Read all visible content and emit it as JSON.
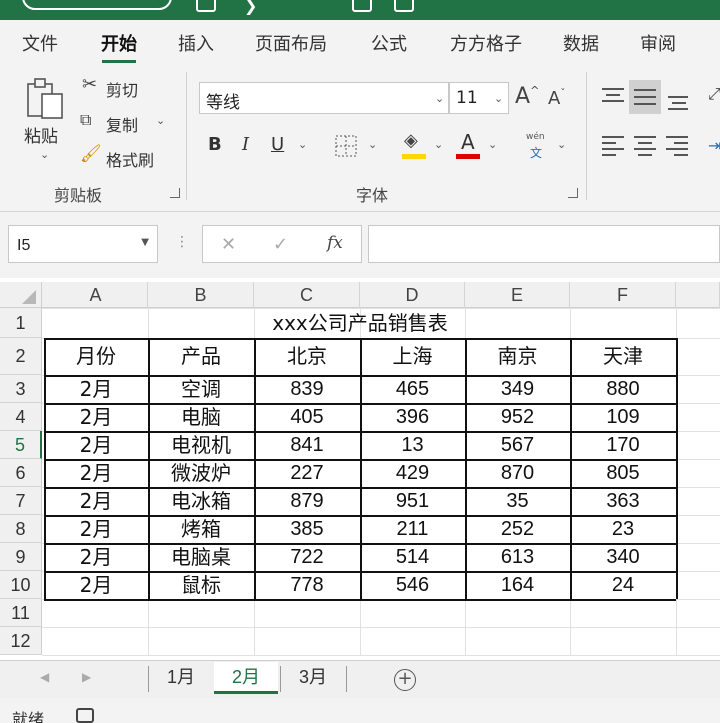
{
  "window": {
    "title_fragment": ""
  },
  "menu": {
    "tabs": [
      "文件",
      "开始",
      "插入",
      "页面布局",
      "公式",
      "方方格子",
      "数据",
      "审阅"
    ],
    "active": "开始"
  },
  "ribbon": {
    "clipboard": {
      "paste_label": "粘贴",
      "cut_label": "剪切",
      "copy_label": "复制",
      "format_painter_label": "格式刷",
      "group_label": "剪贴板"
    },
    "font": {
      "font_name": "等线",
      "font_size": "11",
      "bold": "B",
      "italic": "I",
      "underline": "U",
      "font_color_glyph": "A",
      "phonetic_top": "wén",
      "phonetic_bottom": "文",
      "group_label": "字体",
      "highlight_color": "#ffd700",
      "font_color": "#e00000"
    }
  },
  "formula_bar": {
    "name_box": "I5",
    "cancel_glyph": "✕",
    "enter_glyph": "✓",
    "fx_label": "fx",
    "formula": ""
  },
  "grid": {
    "columns": [
      "A",
      "B",
      "C",
      "D",
      "E",
      "F"
    ],
    "rows": [
      "1",
      "2",
      "3",
      "4",
      "5",
      "6",
      "7",
      "8",
      "9",
      "10",
      "11",
      "12"
    ],
    "selected_row": "5",
    "title": "xxx公司产品销售表",
    "headers": [
      "月份",
      "产品",
      "北京",
      "上海",
      "南京",
      "天津"
    ],
    "data": [
      [
        "2月",
        "空调",
        "839",
        "465",
        "349",
        "880"
      ],
      [
        "2月",
        "电脑",
        "405",
        "396",
        "952",
        "109"
      ],
      [
        "2月",
        "电视机",
        "841",
        "13",
        "567",
        "170"
      ],
      [
        "2月",
        "微波炉",
        "227",
        "429",
        "870",
        "805"
      ],
      [
        "2月",
        "电冰箱",
        "879",
        "951",
        "35",
        "363"
      ],
      [
        "2月",
        "烤箱",
        "385",
        "211",
        "252",
        "23"
      ],
      [
        "2月",
        "电脑桌",
        "722",
        "514",
        "613",
        "340"
      ],
      [
        "2月",
        "鼠标",
        "778",
        "546",
        "164",
        "24"
      ]
    ]
  },
  "sheets": {
    "tabs": [
      "1月",
      "2月",
      "3月"
    ],
    "active": "2月",
    "add_glyph": "+"
  },
  "status": {
    "text": "就绪"
  },
  "colors": {
    "accent": "#217346"
  }
}
